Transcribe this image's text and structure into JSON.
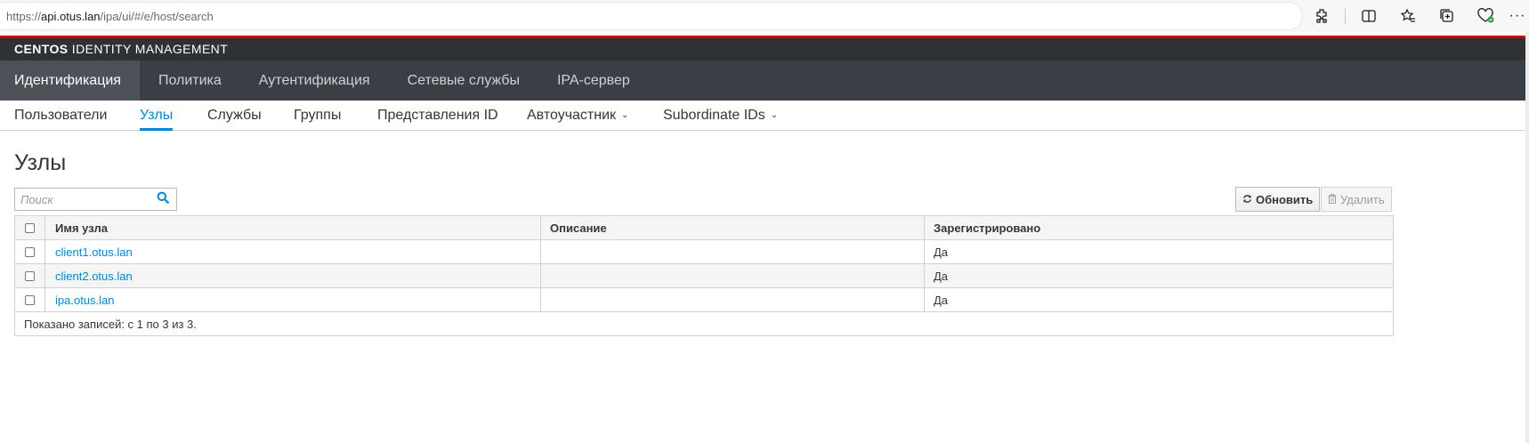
{
  "browser": {
    "url_prefix": "https://",
    "url_host": "api.otus.lan",
    "url_path": "/ipa/ui/#/e/host/search",
    "icons": [
      "extensions-icon",
      "split-screen-icon",
      "favorites-icon",
      "collections-icon",
      "browser-essentials-icon",
      "more-icon"
    ]
  },
  "masthead": {
    "brand_bold": "CENTOS",
    "brand_rest": " IDENTITY MANAGEMENT"
  },
  "primary_nav": [
    {
      "label": "Идентификация",
      "active": true
    },
    {
      "label": "Политика",
      "active": false
    },
    {
      "label": "Аутентификация",
      "active": false
    },
    {
      "label": "Сетевые службы",
      "active": false
    },
    {
      "label": "IPA-сервер",
      "active": false
    }
  ],
  "secondary_nav": [
    {
      "label": "Пользователи",
      "active": false
    },
    {
      "label": "Узлы",
      "active": true
    },
    {
      "label": "Службы",
      "active": false
    },
    {
      "label": "Группы",
      "active": false
    },
    {
      "label": "Представления ID",
      "active": false
    },
    {
      "label": "Автоучастник",
      "active": false,
      "dropdown": true
    },
    {
      "label": "Subordinate IDs",
      "active": false,
      "dropdown": true
    }
  ],
  "page": {
    "title": "Узлы",
    "search_placeholder": "Поиск",
    "refresh_label": "Обновить",
    "delete_label": "Удалить"
  },
  "table": {
    "columns": [
      "Имя узла",
      "Описание",
      "Зарегистрировано"
    ],
    "rows": [
      {
        "name": "client1.otus.lan",
        "description": "",
        "registered": "Да"
      },
      {
        "name": "client2.otus.lan",
        "description": "",
        "registered": "Да"
      },
      {
        "name": "ipa.otus.lan",
        "description": "",
        "registered": "Да"
      }
    ],
    "footer": "Показано записей: с 1 по 3 из 3."
  },
  "colors": {
    "accent": "#cc0000",
    "link": "#0088ce",
    "masthead_bg": "#2f3133",
    "nav_bg": "#393f44"
  }
}
